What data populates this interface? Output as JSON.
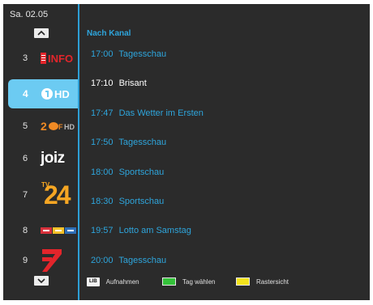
{
  "header": {
    "date": "Sa. 02.05",
    "section_title": "Nach Kanal"
  },
  "channels": [
    {
      "number": "3",
      "logo": "ard-info-logo"
    },
    {
      "number": "4",
      "logo": "das-erste-hd-logo",
      "selected": true
    },
    {
      "number": "5",
      "logo": "zdf-hd-logo"
    },
    {
      "number": "6",
      "logo": "joiz-logo",
      "logo_text": "joiz"
    },
    {
      "number": "7",
      "logo": "tv24-logo",
      "logo_text": "24",
      "logo_small": "TV"
    },
    {
      "number": "8",
      "logo": "swiss-tv-logo"
    },
    {
      "number": "9",
      "logo": "pro7-logo"
    }
  ],
  "info_logo_text": "INFO",
  "hd_logo_text": "HD",
  "programs": [
    {
      "time": "17:00",
      "title": "Tagesschau",
      "current": false
    },
    {
      "time": "17:10",
      "title": "Brisant",
      "current": true
    },
    {
      "time": "17:47",
      "title": "Das Wetter im Ersten",
      "current": false
    },
    {
      "time": "17:50",
      "title": "Tagesschau",
      "current": false
    },
    {
      "time": "18:00",
      "title": "Sportschau",
      "current": false
    },
    {
      "time": "18:30",
      "title": "Sportschau",
      "current": false
    },
    {
      "time": "19:57",
      "title": "Lotto am Samstag",
      "current": false
    },
    {
      "time": "20:00",
      "title": "Tagesschau",
      "current": false
    }
  ],
  "legend": {
    "lib_key": "LIB",
    "record_label": "Aufnahmen",
    "green_label": "Tag wählen",
    "yellow_label": "Rastersicht"
  },
  "colors": {
    "accent": "#2ea5dc",
    "selected_bg": "#6ccbf2",
    "background": "#2b2b2b",
    "green_key": "#34c23a",
    "yellow_key": "#f3e31c"
  }
}
